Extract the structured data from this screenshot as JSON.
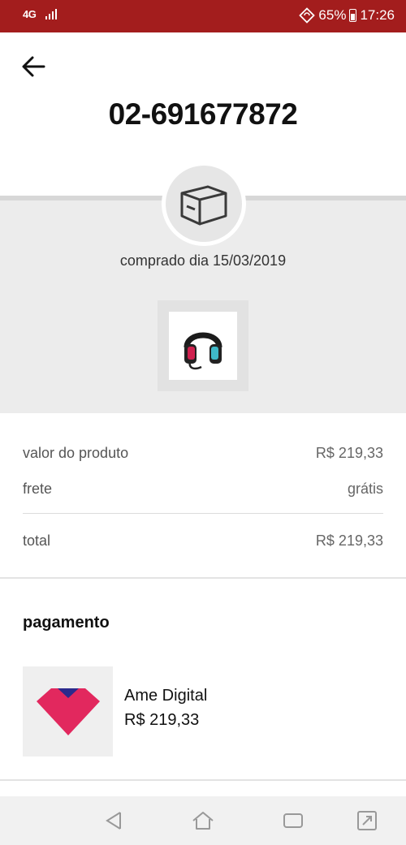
{
  "status_bar": {
    "network_type": "4G",
    "battery_percent": "65%",
    "time": "17:26",
    "color": "#a31d1d",
    "icons": [
      "signal-icon",
      "sync-icon",
      "battery-icon"
    ]
  },
  "header": {
    "back_icon": "arrow-left-icon",
    "order_number": "02-691677872"
  },
  "order": {
    "status_icon": "package-box-icon",
    "purchase_date": "comprado dia 15/03/2019",
    "product_image": "headset-product-icon"
  },
  "summary": {
    "product_value_label": "valor do produto",
    "product_value": "R$ 219,33",
    "shipping_label": "frete",
    "shipping_value": "grátis",
    "total_label": "total",
    "total_value": "R$ 219,33"
  },
  "payment": {
    "title": "pagamento",
    "method_logo": "ame-digital-logo",
    "method_name": "Ame Digital",
    "amount": "R$ 219,33"
  },
  "nav_bar": {
    "icons": [
      "back-triangle-icon",
      "home-icon",
      "recent-apps-icon",
      "expand-screen-icon"
    ]
  }
}
